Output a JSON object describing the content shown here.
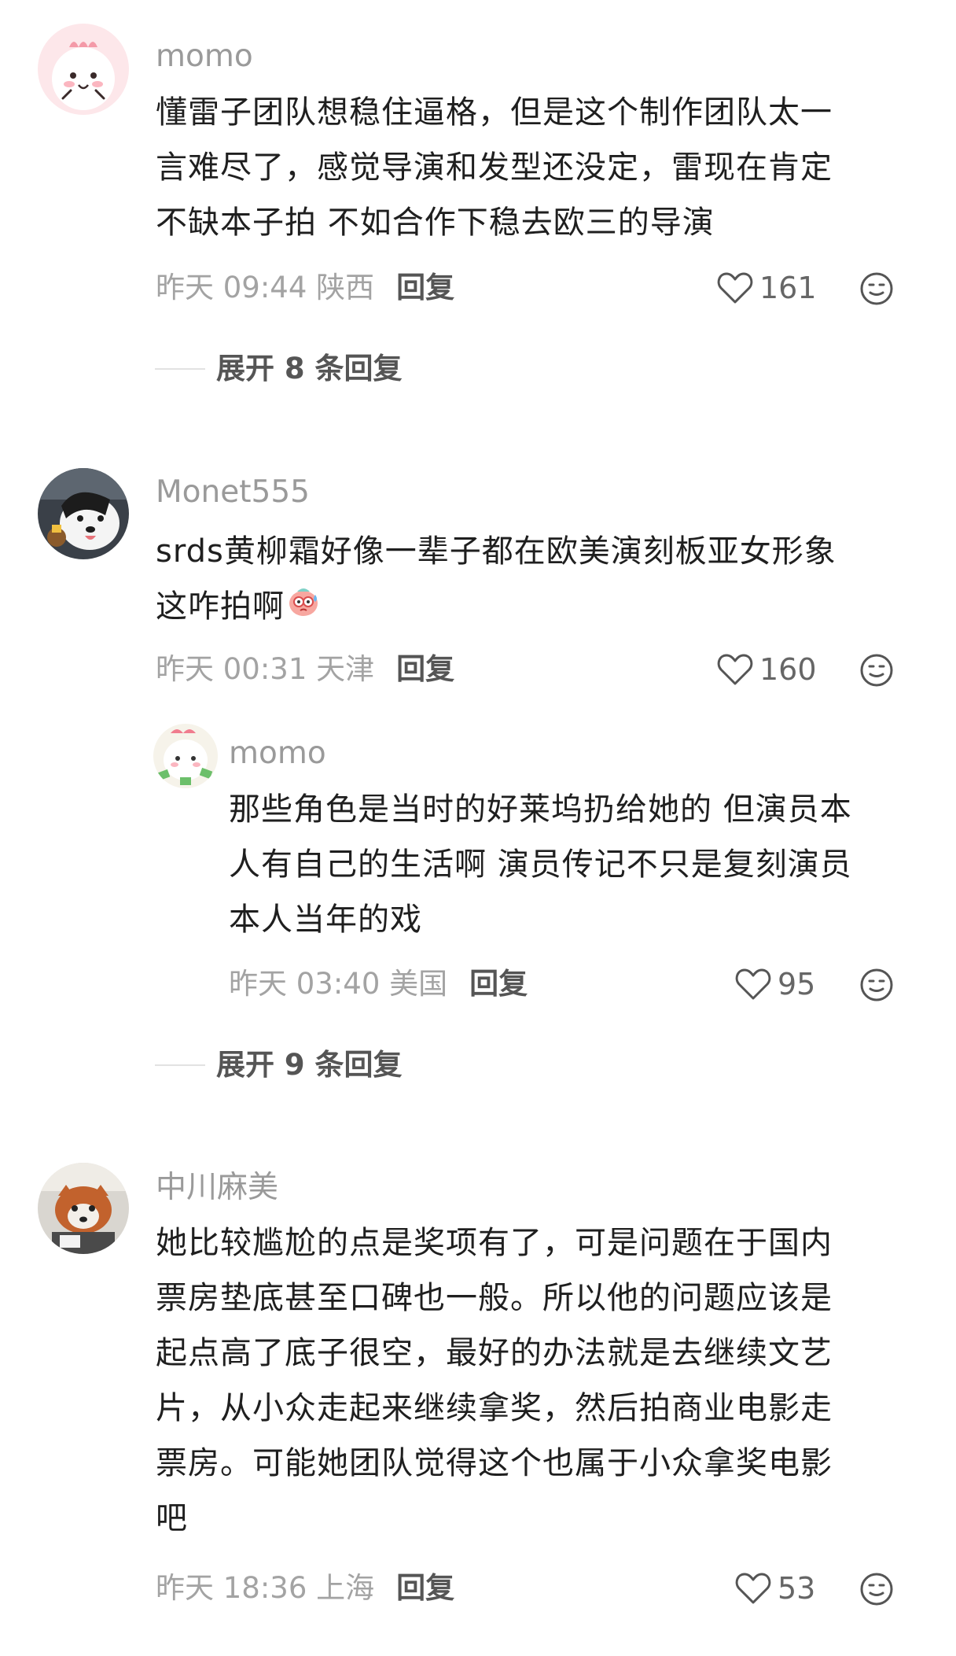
{
  "comments": [
    {
      "username": "momo",
      "lines": [
        "懂雷子团队想稳住逼格，但是这个制作团队太一",
        "言难尽了，感觉导演和发型还没定，雷现在肯定",
        "不缺本子拍 不如合作下稳去欧三的导演"
      ],
      "time_location": "昨天 09:44 陕西",
      "reply_label": "回复",
      "likes": "161",
      "expand_label": "展开 8 条回复"
    },
    {
      "username": "Monet555",
      "lines": [
        "srds黄柳霜好像一辈子都在欧美演刻板亚女形象",
        "这咋拍啊"
      ],
      "time_location": "昨天 00:31 天津",
      "reply_label": "回复",
      "likes": "160",
      "reply": {
        "username": "momo",
        "lines": [
          "那些角色是当时的好莱坞扔给她的 但演员本",
          "人有自己的生活啊 演员传记不只是复刻演员",
          "本人当年的戏"
        ],
        "time_location": "昨天 03:40 美国",
        "reply_label": "回复",
        "likes": "95"
      },
      "expand_label": "展开 9 条回复"
    },
    {
      "username": "中川麻美",
      "lines": [
        "她比较尴尬的点是奖项有了，可是问题在于国内",
        "票房垫底甚至口碑也一般。所以他的问题应该是",
        "起点高了底子很空，最好的办法就是去继续文艺",
        "片，从小众走起来继续拿奖，然后拍商业电影走",
        "票房。可能她团队觉得这个也属于小众拿奖电影",
        "吧"
      ],
      "time_location": "昨天 18:36 上海",
      "reply_label": "回复",
      "likes": "53"
    }
  ],
  "icons": {
    "like": "heart-outline-icon",
    "react": "smiley-face-icon"
  },
  "colors": {
    "text": "#1f1f1f",
    "muted": "#9a9a9a",
    "action": "#555555"
  }
}
